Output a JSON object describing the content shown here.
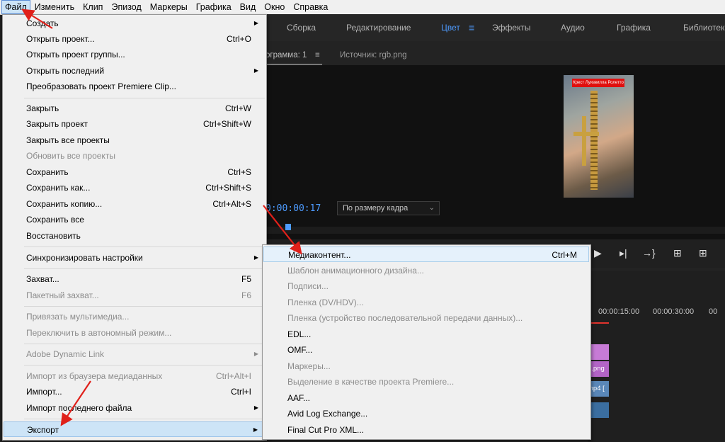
{
  "menubar": {
    "items": [
      "Файл",
      "Изменить",
      "Клип",
      "Эпизод",
      "Маркеры",
      "Графика",
      "Вид",
      "Окно",
      "Справка"
    ]
  },
  "workspaces": {
    "items": [
      "Сборка",
      "Редактирование",
      "Цвет",
      "Эффекты",
      "Аудио",
      "Графика",
      "Библиотеки"
    ],
    "active": "Цвет"
  },
  "panels": {
    "program_tab": "ограмма: 1",
    "source_tab": "Источник: rgb.png",
    "timecode": "0:00:00:17",
    "zoom_select": "По размеру кадра",
    "preview_caption": "Крест Луизвилла Ролетто"
  },
  "timeline": {
    "ruler_times": [
      "00:00:15:00",
      "00:00:30:00",
      "00"
    ],
    "clip_labels": [
      "b.png",
      "mp4 ["
    ]
  },
  "file_menu": {
    "items": [
      {
        "label": "Создать",
        "shortcut": "",
        "submenu": true,
        "enabled": true
      },
      {
        "label": "Открыть проект...",
        "shortcut": "Ctrl+O",
        "submenu": false,
        "enabled": true
      },
      {
        "label": "Открыть проект группы...",
        "shortcut": "",
        "submenu": false,
        "enabled": true
      },
      {
        "label": "Открыть последний",
        "shortcut": "",
        "submenu": true,
        "enabled": true
      },
      {
        "label": "Преобразовать проект Premiere Clip...",
        "shortcut": "",
        "submenu": false,
        "enabled": true
      },
      {
        "label": "Закрыть",
        "shortcut": "Ctrl+W",
        "submenu": false,
        "enabled": true
      },
      {
        "label": "Закрыть проект",
        "shortcut": "Ctrl+Shift+W",
        "submenu": false,
        "enabled": true
      },
      {
        "label": "Закрыть все проекты",
        "shortcut": "",
        "submenu": false,
        "enabled": true
      },
      {
        "label": "Обновить все проекты",
        "shortcut": "",
        "submenu": false,
        "enabled": false
      },
      {
        "label": "Сохранить",
        "shortcut": "Ctrl+S",
        "submenu": false,
        "enabled": true
      },
      {
        "label": "Сохранить как...",
        "shortcut": "Ctrl+Shift+S",
        "submenu": false,
        "enabled": true
      },
      {
        "label": "Сохранить копию...",
        "shortcut": "Ctrl+Alt+S",
        "submenu": false,
        "enabled": true
      },
      {
        "label": "Сохранить все",
        "shortcut": "",
        "submenu": false,
        "enabled": true
      },
      {
        "label": "Восстановить",
        "shortcut": "",
        "submenu": false,
        "enabled": true
      },
      {
        "label": "Синхронизировать настройки",
        "shortcut": "",
        "submenu": true,
        "enabled": true
      },
      {
        "label": "Захват...",
        "shortcut": "F5",
        "submenu": false,
        "enabled": true
      },
      {
        "label": "Пакетный захват...",
        "shortcut": "F6",
        "submenu": false,
        "enabled": false
      },
      {
        "label": "Привязать мультимедиа...",
        "shortcut": "",
        "submenu": false,
        "enabled": false
      },
      {
        "label": "Переключить в автономный режим...",
        "shortcut": "",
        "submenu": false,
        "enabled": false
      },
      {
        "label": "Adobe Dynamic Link",
        "shortcut": "",
        "submenu": true,
        "enabled": false
      },
      {
        "label": "Импорт из браузера медиаданных",
        "shortcut": "Ctrl+Alt+I",
        "submenu": false,
        "enabled": false
      },
      {
        "label": "Импорт...",
        "shortcut": "Ctrl+I",
        "submenu": false,
        "enabled": true
      },
      {
        "label": "Импорт последнего файла",
        "shortcut": "",
        "submenu": true,
        "enabled": true
      },
      {
        "label": "Экспорт",
        "shortcut": "",
        "submenu": true,
        "enabled": true
      }
    ]
  },
  "export_menu": {
    "items": [
      {
        "label": "Медиаконтент...",
        "shortcut": "Ctrl+M",
        "enabled": true
      },
      {
        "label": "Шаблон анимационного дизайна...",
        "shortcut": "",
        "enabled": false
      },
      {
        "label": "Подписи...",
        "shortcut": "",
        "enabled": false
      },
      {
        "label": "Пленка (DV/HDV)...",
        "shortcut": "",
        "enabled": false
      },
      {
        "label": "Пленка (устройство последовательной передачи данных)...",
        "shortcut": "",
        "enabled": false
      },
      {
        "label": "EDL...",
        "shortcut": "",
        "enabled": true
      },
      {
        "label": "OMF...",
        "shortcut": "",
        "enabled": true
      },
      {
        "label": "Маркеры...",
        "shortcut": "",
        "enabled": false
      },
      {
        "label": "Выделение в качестве проекта Premiere...",
        "shortcut": "",
        "enabled": false
      },
      {
        "label": "AAF...",
        "shortcut": "",
        "enabled": true
      },
      {
        "label": "Avid Log Exchange...",
        "shortcut": "",
        "enabled": true
      },
      {
        "label": "Final Cut Pro XML...",
        "shortcut": "",
        "enabled": true
      }
    ]
  },
  "colors": {
    "accent_blue": "#4d9bff",
    "annotation_red": "#e0201a",
    "menu_bg": "#f0f0f0",
    "disabled_text": "#8c8c8c"
  }
}
